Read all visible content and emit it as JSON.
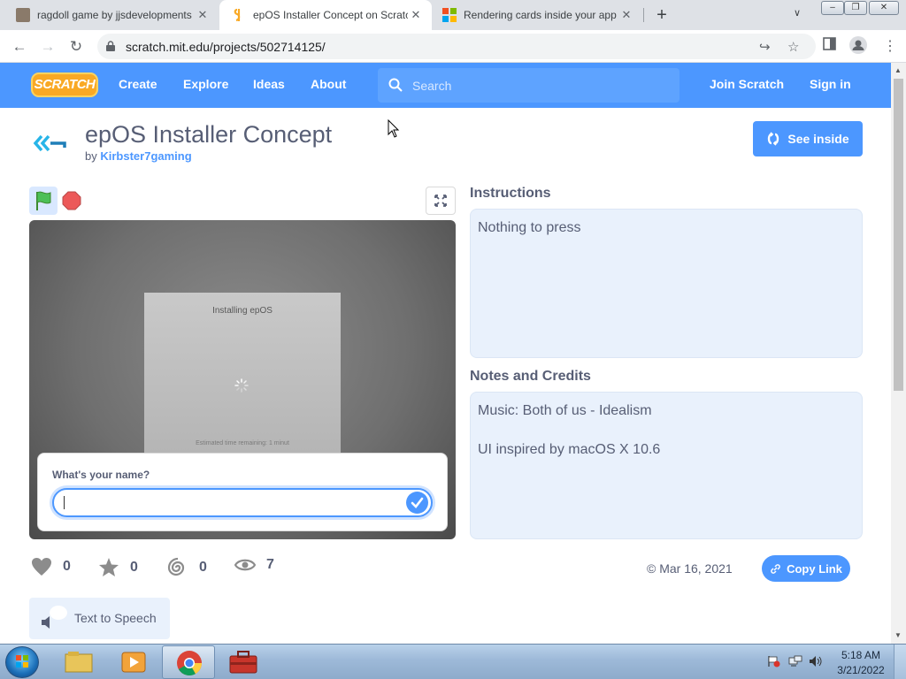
{
  "browser": {
    "tabs": [
      {
        "title": "ragdoll game by jjsdevelopments",
        "favicon": "ragdoll-favicon"
      },
      {
        "title": "epOS Installer Concept on Scratch",
        "favicon": "scratch-favicon"
      },
      {
        "title": "Rendering cards inside your app",
        "favicon": "microsoft-favicon"
      }
    ],
    "close_tab": "✕",
    "new_tab": "+",
    "url": "scratch.mit.edu/projects/502714125/",
    "window_controls": {
      "minimize": "–",
      "maximize": "❐",
      "close": "✕"
    }
  },
  "scratch_nav": {
    "logo": "SCRATCH",
    "links": [
      "Create",
      "Explore",
      "Ideas",
      "About"
    ],
    "search_placeholder": "Search",
    "join": "Join Scratch",
    "signin": "Sign in"
  },
  "project": {
    "title": "epOS Installer Concept",
    "by_prefix": "by",
    "author": "Kirbster7gaming",
    "see_inside": "See inside"
  },
  "stage": {
    "installer_heading": "Installing epOS",
    "eta": "Estimated time remaining: 1 minut",
    "ask_question": "What's your name?",
    "ask_value": ""
  },
  "instructions": {
    "title": "Instructions",
    "text": "Nothing to press"
  },
  "notes": {
    "title": "Notes and Credits",
    "lines": [
      "Music: Both of us - Idealism",
      "UI inspired by macOS X 10.6"
    ]
  },
  "stats": {
    "loves": "0",
    "favorites": "0",
    "remixes": "0",
    "views": "7"
  },
  "shared_date": "© Mar 16, 2021",
  "copy_link": "Copy Link",
  "tts_label": "Text to Speech",
  "taskbar": {
    "time": "5:18 AM",
    "date": "3/21/2022"
  },
  "colors": {
    "scratch_blue": "#4c97ff",
    "text": "#575e75",
    "panel": "#e9f1fc"
  }
}
